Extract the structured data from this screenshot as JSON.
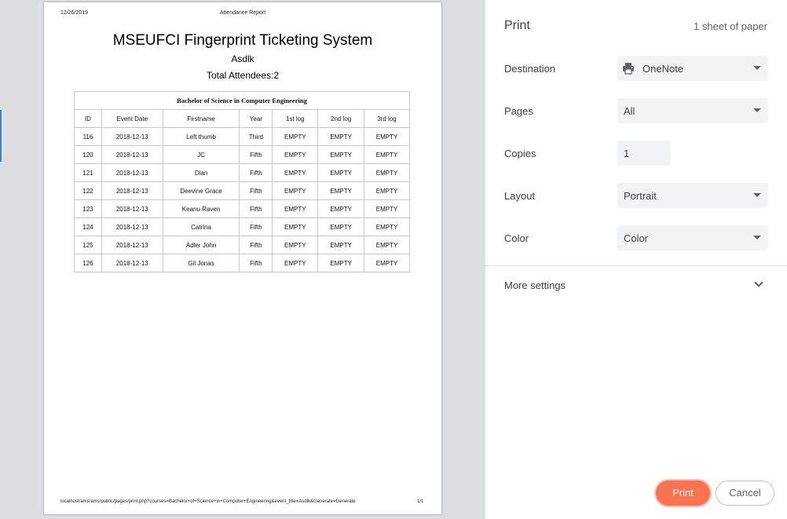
{
  "preview": {
    "header_date": "12/26/2019",
    "header_title": "Attendance Report",
    "doc_title": "MSEUFCI Fingerprint Ticketing System",
    "event_title": "Asdlk",
    "attendees": "Total Attendees:2",
    "table": {
      "caption": "Bachelor of Science in Computer Engineering",
      "columns": [
        "ID",
        "Event Date",
        "Firstname",
        "Year",
        "1st log",
        "2nd log",
        "3rd log"
      ],
      "rows": [
        [
          "116",
          "2018-12-13",
          "Left thumb",
          "Third",
          "EMPTY",
          "EMPTY",
          "EMPTY"
        ],
        [
          "120",
          "2018-12-13",
          "JC",
          "Fifth",
          "EMPTY",
          "EMPTY",
          "EMPTY"
        ],
        [
          "121",
          "2018-12-13",
          "Dian",
          "Fifth",
          "EMPTY",
          "EMPTY",
          "EMPTY"
        ],
        [
          "122",
          "2018-12-13",
          "Deevine Grace",
          "Fifth",
          "EMPTY",
          "EMPTY",
          "EMPTY"
        ],
        [
          "123",
          "2018-12-13",
          "Keanu Raven",
          "Fifth",
          "EMPTY",
          "EMPTY",
          "EMPTY"
        ],
        [
          "124",
          "2018-12-13",
          "Catrina",
          "Fifth",
          "EMPTY",
          "EMPTY",
          "EMPTY"
        ],
        [
          "125",
          "2018-12-13",
          "Adler John",
          "Fifth",
          "EMPTY",
          "EMPTY",
          "EMPTY"
        ],
        [
          "126",
          "2018-12-13",
          "Gil Jonas",
          "Fifth",
          "EMPTY",
          "EMPTY",
          "EMPTY"
        ]
      ]
    },
    "footer_url": "localhost/ams/ams/public/pages/print.php?courses=Bachelor+of+Science+in+Computer+Engineering&event_title=Asdlk&Generate=Generate",
    "footer_page": "1/1"
  },
  "panel": {
    "title": "Print",
    "sheet_count": "1 sheet of paper",
    "destination": {
      "label": "Destination",
      "value": "OneNote",
      "icon": "printer-icon"
    },
    "pages": {
      "label": "Pages",
      "value": "All"
    },
    "copies": {
      "label": "Copies",
      "value": "1"
    },
    "layout": {
      "label": "Layout",
      "value": "Portrait"
    },
    "color": {
      "label": "Color",
      "value": "Color"
    },
    "more_settings": "More settings",
    "print_label": "Print",
    "cancel_label": "Cancel",
    "accent_color": "#f97351"
  }
}
